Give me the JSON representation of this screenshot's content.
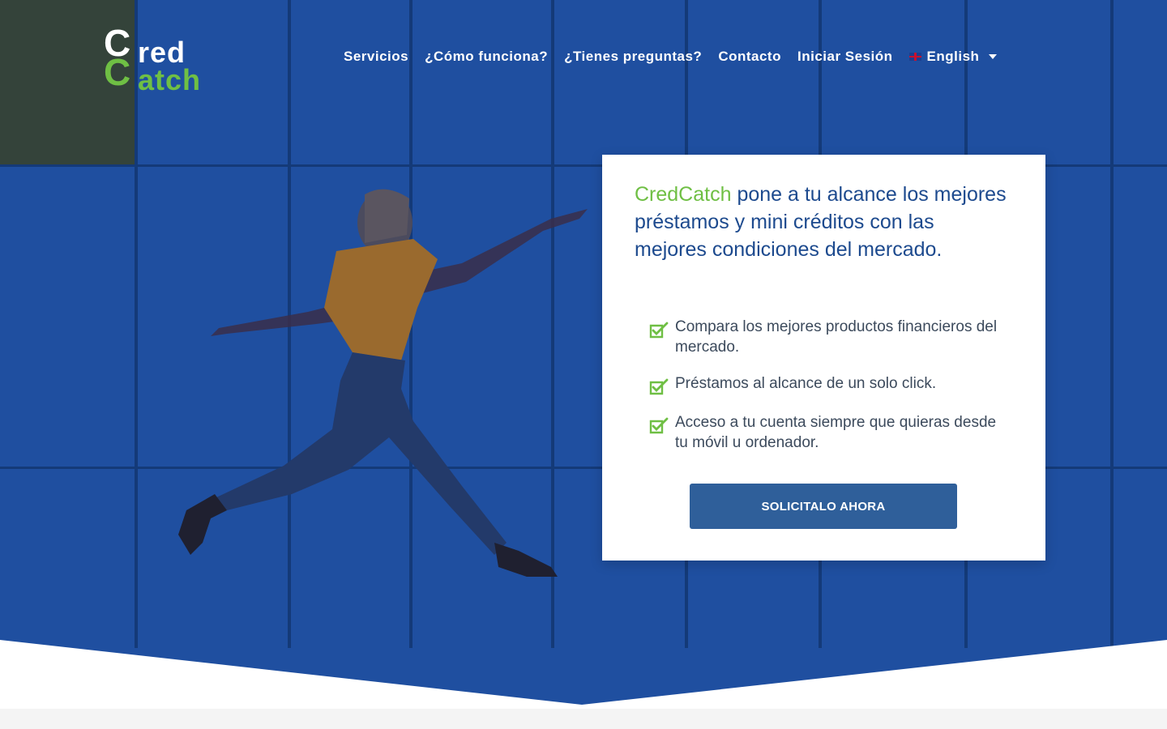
{
  "brand": {
    "logo_top": "red",
    "logo_bottom": "atch",
    "logo_initial": "C",
    "colors": {
      "green": "#6fbf44",
      "navy": "#1d4a8e",
      "hero_blue": "#1f4fa0",
      "button": "#2f5f9a"
    }
  },
  "nav": {
    "items": [
      {
        "label": "Servicios"
      },
      {
        "label": "¿Cómo funciona?"
      },
      {
        "label": "¿Tienes preguntas?"
      },
      {
        "label": "Contacto"
      },
      {
        "label": "Iniciar Sesión"
      }
    ],
    "language": {
      "label": "English",
      "icon": "uk-flag-icon"
    }
  },
  "card": {
    "brand_word": "CredCatch",
    "headline_rest": " pone a tu alcance los mejores préstamos y mini créditos con las mejores condiciones del mercado.",
    "features": [
      {
        "text": "Compara los mejores productos financieros del mercado.",
        "icon": "check-square-icon"
      },
      {
        "text": "Préstamos al alcance de un solo click.",
        "icon": "check-square-icon"
      },
      {
        "text": "Acceso a tu cuenta siempre que quieras desde tu móvil u ordenador.",
        "icon": "check-square-icon"
      }
    ],
    "cta_label": "SOLICITALO AHORA"
  }
}
